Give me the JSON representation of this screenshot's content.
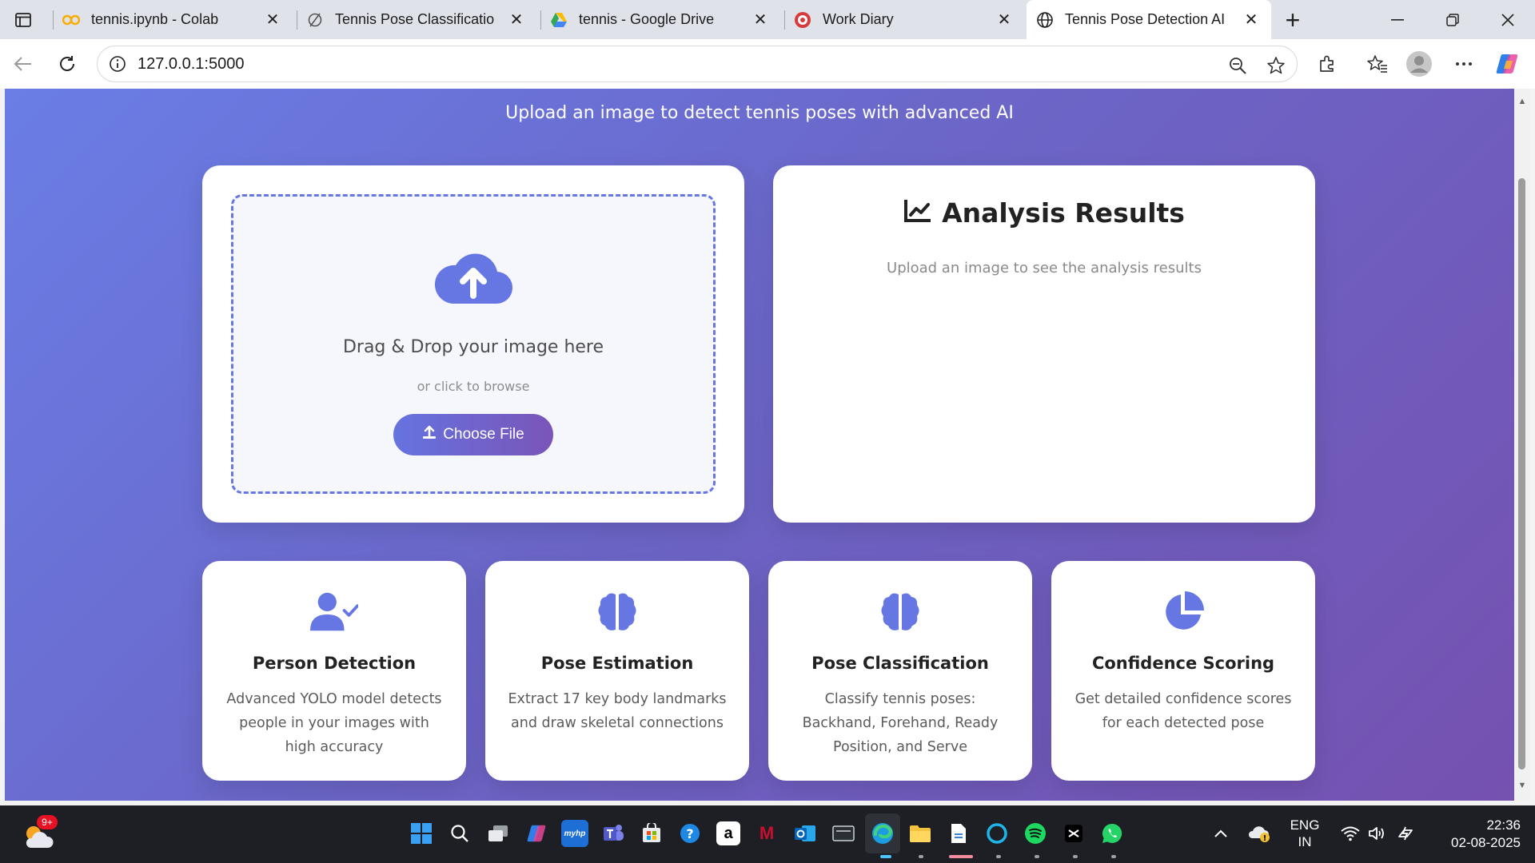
{
  "browser": {
    "tabs": [
      {
        "title": "tennis.ipynb - Colab",
        "icon": "colab-icon",
        "active": false
      },
      {
        "title": "Tennis Pose Classification F",
        "icon": "roboflow-icon",
        "active": false
      },
      {
        "title": "tennis - Google Drive",
        "icon": "drive-icon",
        "active": false
      },
      {
        "title": "Work Diary",
        "icon": "work-diary-icon",
        "active": false
      },
      {
        "title": "Tennis Pose Detection AI",
        "icon": "globe-icon",
        "active": true
      }
    ],
    "url": "127.0.0.1:5000"
  },
  "page": {
    "subtitle": "Upload an image to detect tennis poses with advanced AI",
    "upload": {
      "title": "Drag & Drop your image here",
      "subtitle": "or click to browse",
      "button_label": "Choose File"
    },
    "results": {
      "title": "Analysis Results",
      "placeholder": "Upload an image to see the analysis results"
    },
    "features": [
      {
        "icon": "user-check-icon",
        "title": "Person Detection",
        "desc": "Advanced YOLO model detects people in your images with high accuracy"
      },
      {
        "icon": "brain-icon",
        "title": "Pose Estimation",
        "desc": "Extract 17 key body landmarks and draw skeletal connections"
      },
      {
        "icon": "brain-icon",
        "title": "Pose Classification",
        "desc": "Classify tennis poses: Backhand, Forehand, Ready Position, and Serve"
      },
      {
        "icon": "pie-chart-icon",
        "title": "Confidence Scoring",
        "desc": "Get detailed confidence scores for each detected pose"
      }
    ],
    "accent_color": "#6677e3",
    "gradient": [
      "#6a7ee6",
      "#7551b0"
    ]
  },
  "taskbar": {
    "weather_badge": "9+",
    "language": "ENG",
    "region": "IN",
    "time": "22:36",
    "date": "02-08-2025",
    "amazon_label": "a",
    "mcafee_label": "M",
    "myhp_label": "myhp"
  }
}
